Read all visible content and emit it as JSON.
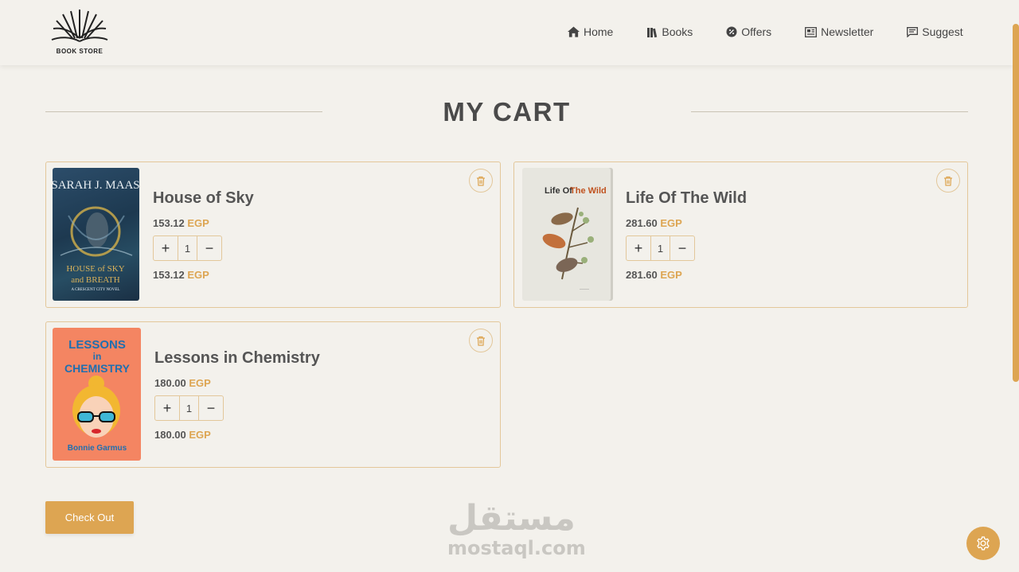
{
  "brand": {
    "logo_text": "BOOK STORE"
  },
  "nav": {
    "home": "Home",
    "books": "Books",
    "offers": "Offers",
    "newsletter": "Newsletter",
    "suggest": "Suggest"
  },
  "page": {
    "title": "MY CART"
  },
  "currency": "EGP",
  "cart": [
    {
      "title": "House of Sky",
      "price": "153.12",
      "quantity": "1",
      "subtotal": "153.12",
      "cover": {
        "author": "SARAH J. MAAS",
        "line1": "HOUSE of SKY",
        "line2": "and BREATH",
        "series": "A CRESCENT CITY NOVEL"
      }
    },
    {
      "title": "Life Of The Wild",
      "price": "281.60",
      "quantity": "1",
      "subtotal": "281.60",
      "cover": {
        "title_a": "Life Of",
        "title_b": "The Wild"
      }
    },
    {
      "title": "Lessons in Chemistry",
      "price": "180.00",
      "quantity": "1",
      "subtotal": "180.00",
      "cover": {
        "line1": "LESSONS",
        "line2": "in",
        "line3": "CHEMISTRY",
        "author": "Bonnie Garmus"
      }
    }
  ],
  "checkout_label": "Check Out",
  "watermark": {
    "arabic": "مستقل",
    "latin": "mostaql.com"
  },
  "colors": {
    "accent": "#dda552",
    "background": "#f3f1ec",
    "border": "#e3c79a"
  }
}
